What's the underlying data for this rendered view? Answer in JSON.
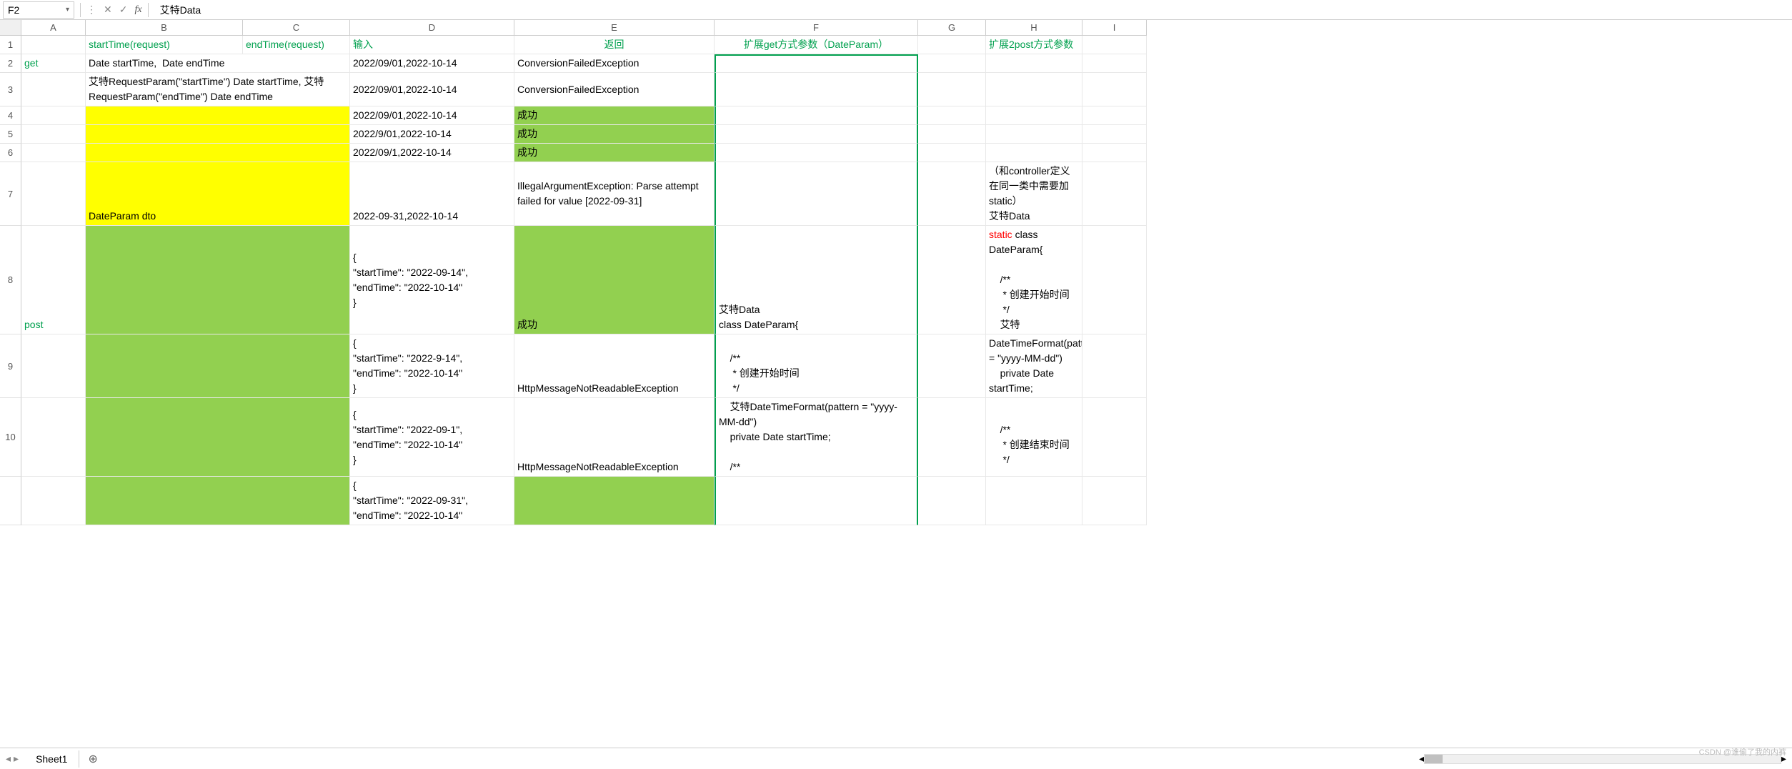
{
  "nameBox": "F2",
  "formulaValue": "艾特Data",
  "columns": [
    "A",
    "B",
    "C",
    "D",
    "E",
    "F",
    "G",
    "H",
    "I"
  ],
  "rowNumbers": [
    "1",
    "2",
    "3",
    "4",
    "5",
    "6",
    "7",
    "8",
    "9",
    "10"
  ],
  "sheetName": "Sheet1",
  "watermark": "CSDN @谁偷了我的内裤",
  "r1": {
    "B": "startTime(request)",
    "C": "endTime(request)",
    "D": "输入",
    "E": "返回",
    "F": "扩展get方式参数（DateParam）",
    "H": "扩展2post方式参数"
  },
  "r2": {
    "A": "get",
    "B": "Date startTime,  Date endTime",
    "D": "2022/09/01,2022-10-14",
    "E": "ConversionFailedException"
  },
  "r3": {
    "B": "艾特RequestParam(\"startTime\") Date startTime, 艾特RequestParam(\"endTime\") Date endTime",
    "D": "2022/09/01,2022-10-14",
    "E": "ConversionFailedException"
  },
  "r4": {
    "D": "2022/09/01,2022-10-14",
    "E": "成功"
  },
  "r5": {
    "D": "2022/9/01,2022-10-14",
    "E": "成功"
  },
  "r6": {
    "D": "2022/09/1,2022-10-14",
    "E": "成功"
  },
  "r7": {
    "B": "DateParam dto",
    "D": "2022-09-31,2022-10-14",
    "E": "IllegalArgumentException: Parse attempt failed for value [2022-09-31]",
    "H": "（和controller定义在同一类中需要加static）\n艾特Data"
  },
  "r8": {
    "A": "post",
    "D": "{\n\"startTime\": \"2022-09-14\",\n\"endTime\": \"2022-10-14\"\n}",
    "E": "成功",
    "F": "艾特Data\nclass DateParam{",
    "H_pre": "static",
    "H_post": " class DateParam{\n\n    /**\n     * 创建开始时间\n     */\n    艾特"
  },
  "r9": {
    "D": "{\n\"startTime\": \"2022-9-14\",\n\"endTime\": \"2022-10-14\"\n}",
    "E": "HttpMessageNotReadableException",
    "F": "    /**\n     * 创建开始时间\n     */",
    "H": "DateTimeFormat(pattern = \"yyyy-MM-dd\")\n    private Date startTime;"
  },
  "r10": {
    "D": "{\n\"startTime\": \"2022-09-1\",\n\"endTime\": \"2022-10-14\"\n}",
    "E": "HttpMessageNotReadableException",
    "F": "    艾特DateTimeFormat(pattern = \"yyyy-MM-dd\")\n    private Date startTime;\n\n    /**",
    "H": "\n    /**\n     * 创建结束时间\n     */"
  },
  "r11": {
    "D": "{\n\"startTime\": \"2022-09-31\",\n\"endTime\": \"2022-10-14\""
  }
}
